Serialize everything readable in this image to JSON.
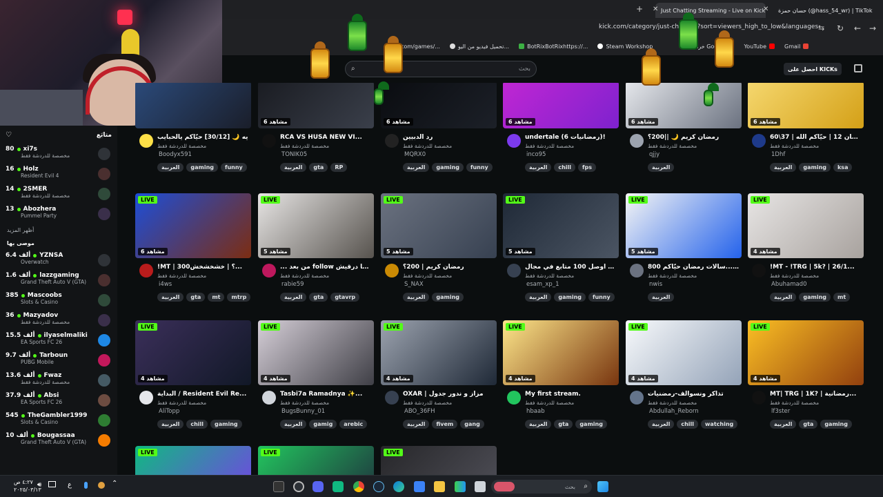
{
  "browser": {
    "tabs": [
      {
        "label": "حسان حمزة (@hass_54_wr) | TikTok",
        "active": false
      },
      {
        "label": "Just Chatting Streaming - Live on Kick",
        "active": true
      }
    ],
    "url": "kick.com/category/just-chatting?sort=viewers_high_to_low&languages=ar",
    "bookmarks": [
      "km.com/games/...",
      "تحميل فيديو من اليو...",
      "BotRixBotRixhttps://...",
      "Steam Workshop",
      "خرائط Google",
      "YouTube",
      "Gmail"
    ]
  },
  "header": {
    "search_placeholder": "بحث",
    "get_kicks": "احصل على KICKs"
  },
  "sidebar": {
    "following_title": "متابَع",
    "following": [
      {
        "viewers": "80",
        "name": "xi7s",
        "category": "مخصصة للدردشة فقط"
      },
      {
        "viewers": "16",
        "name": "Holz",
        "category": "Resident Evil 4"
      },
      {
        "viewers": "14",
        "name": "2SMER",
        "category": "مخصصة للدردشة فقط"
      },
      {
        "viewers": "13",
        "name": "Abozhera",
        "category": "Pummel Party"
      }
    ],
    "show_more": "أظهر المزيد",
    "recommended_title": "موصى بها",
    "recommended": [
      {
        "viewers": "6.4 ألف",
        "name": "YZNSA",
        "category": "Overwatch"
      },
      {
        "viewers": "1.6 ألف",
        "name": "lazzgaming",
        "category": "Grand Theft Auto V (GTA)"
      },
      {
        "viewers": "385",
        "name": "Mascoobs",
        "category": "Slots & Casino"
      },
      {
        "viewers": "36",
        "name": "Mazyadov",
        "category": "مخصصة للدردشة فقط"
      },
      {
        "viewers": "15.5 ألف",
        "name": "ilyaselmaliki",
        "category": "EA Sports FC 26"
      },
      {
        "viewers": "9.7 ألف",
        "name": "Tarboun",
        "category": "PUBG Mobile"
      },
      {
        "viewers": "13.6 ألف",
        "name": "Fwaz",
        "category": "مخصصة للدردشة فقط"
      },
      {
        "viewers": "37.9 ألف",
        "name": "Absi",
        "category": "EA Sports FC 26"
      },
      {
        "viewers": "545",
        "name": "TheGambler1999",
        "category": "Slots & Casino"
      },
      {
        "viewers": "10 ألف",
        "name": "Bougassaa",
        "category": "Grand Theft Auto V (GTA)"
      }
    ]
  },
  "cards": [
    {
      "live": "LIVE",
      "viewers": "",
      "title": "يه 🌙 [30/12] حيّاكم يالحبايب",
      "category": "مخصصة للدردشة فقط",
      "user": "Boodyx591",
      "tags": [
        "العربية",
        "gaming",
        "funny"
      ]
    },
    {
      "live": "LIVE",
      "viewers": "6 مشاهد",
      "title": "RCA VS HUSA NEW VI...",
      "category": "مخصصة للدردشة فقط",
      "user": "TONIK05",
      "tags": [
        "العربية",
        "gta",
        "RP"
      ]
    },
    {
      "live": "LIVE",
      "viewers": "6 مشاهد",
      "title": "رد الدبيين",
      "category": "مخصصة للدردشة فقط",
      "user": "MQRX0",
      "tags": [
        "العربية",
        "gaming",
        "funny"
      ]
    },
    {
      "live": "LIVE",
      "viewers": "6 مشاهد",
      "title": "undertale (رمضانيات 6)!",
      "category": "مخصصة للدردشة فقط",
      "user": "inco95",
      "tags": [
        "العربية",
        "chill",
        "fps"
      ]
    },
    {
      "live": "LIVE",
      "viewers": "6 مشاهد",
      "title": "رمضان كريم 🌙 ||200؟",
      "category": "مخصصة للدردشة فقط",
      "user": "qjjy",
      "tags": [
        "العربية"
      ]
    },
    {
      "live": "LIVE",
      "viewers": "6 مشاهد",
      "title": "رمضان 12 | حيّاكم الله | 37\\60",
      "category": "مخصصة للدردشة فقط",
      "user": "1Dhf",
      "tags": [
        "العربية",
        "gaming",
        "ksa"
      ]
    },
    {
      "live": "LIVE",
      "viewers": "6 مشاهد",
      "title": "!MT | 300؟ | خشخشخش...",
      "category": "مخصصة للدردشة فقط",
      "user": "i4ws",
      "tags": [
        "العربية",
        "gta",
        "mt",
        "mtrp"
      ]
    },
    {
      "live": "LIVE",
      "viewers": "5 مشاهد",
      "title": "... من بعد follow إلى ما درقيش",
      "category": "مخصصة للدردشة فقط",
      "user": "rabie59",
      "tags": [
        "العربية",
        "gta",
        "gtavrp"
      ]
    },
    {
      "live": "LIVE",
      "viewers": "5 مشاهد",
      "title": "رمضان كريم | 200؟",
      "category": "مخصصة للدردشة فقط",
      "user": "S_NAX",
      "tags": [
        "العربية",
        "gaming"
      ]
    },
    {
      "live": "LIVE",
      "viewers": "5 مشاهد",
      "title": "بدي اوصل 100 متابع في مجال",
      "category": "مخصصة للدردشة فقط",
      "user": "esam_xp_1",
      "tags": [
        "العربية",
        "gaming",
        "funny"
      ]
    },
    {
      "live": "LIVE",
      "viewers": "5 مشاهد",
      "title": "800 ؟ | ...سالات رمضان حيّاكم",
      "category": "مخصصة للدردشة فقط",
      "user": "nwis",
      "tags": [
        "العربية"
      ]
    },
    {
      "live": "LIVE",
      "viewers": "4 مشاهد",
      "title": "!MT - !TRG | 5k? | 26/1...",
      "category": "مخصصة للدردشة فقط",
      "user": "Abuhamad0",
      "tags": [
        "العربية",
        "gaming",
        "mt"
      ]
    },
    {
      "live": "LIVE",
      "viewers": "4 مشاهد",
      "title": "البداية / Resident Evil Re...",
      "category": "مخصصة للدردشة فقط",
      "user": "AliTopp",
      "tags": [
        "العربية",
        "chill",
        "gaming"
      ]
    },
    {
      "live": "LIVE",
      "viewers": "4 مشاهد",
      "title": "Tasbi7a Ramadnya ✨...",
      "category": "مخصصة للدردشة فقط",
      "user": "BugsBunny_01",
      "tags": [
        "العربية",
        "gamig",
        "arebic"
      ]
    },
    {
      "live": "LIVE",
      "viewers": "4 مشاهد",
      "title": "OXAR | مزاز و ندور جدول",
      "category": "مخصصة للدردشة فقط",
      "user": "ABO_36FH",
      "tags": [
        "العربية",
        "fivem",
        "gang"
      ]
    },
    {
      "live": "LIVE",
      "viewers": "4 مشاهد",
      "title": "My first stream.",
      "category": "مخصصة للدردشة فقط",
      "user": "hbaab",
      "tags": [
        "العربية",
        "gta",
        "gaming"
      ]
    },
    {
      "live": "LIVE",
      "viewers": "4 مشاهد",
      "title": "تذاكر ونسوالف-رمضنيات",
      "category": "مخصصة للدردشة فقط",
      "user": "Abdullah_Reborn",
      "tags": [
        "العربية",
        "chill",
        "watching"
      ]
    },
    {
      "live": "LIVE",
      "viewers": "4 مشاهد",
      "title": "MT| TRG | 1K? | رمضانية...",
      "category": "مخصصة للدردشة فقط",
      "user": "lf3ster",
      "tags": [
        "العربية",
        "gta",
        "gaming"
      ]
    },
    {
      "live": "LIVE",
      "viewers": "",
      "title": "",
      "category": "",
      "user": "",
      "tags": []
    },
    {
      "live": "LIVE",
      "viewers": "",
      "title": "",
      "category": "",
      "user": "",
      "tags": []
    },
    {
      "live": "LIVE",
      "viewers": "",
      "title": "",
      "category": "",
      "user": "",
      "tags": []
    }
  ],
  "taskbar": {
    "search_placeholder": "بحث",
    "time": "٤:٢٧ ص",
    "date": "٢٠٢٥/٠٣/١٣",
    "input_lang": "ع"
  },
  "colors": {
    "accent": "#53fc18",
    "bg": "#0b0e0f",
    "sidebar": "#121416"
  }
}
